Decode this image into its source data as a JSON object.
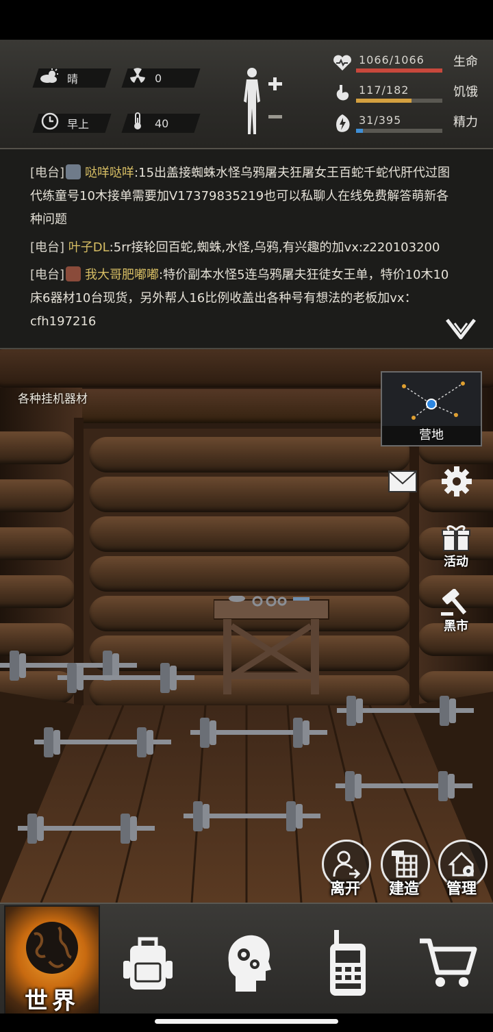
{
  "hud": {
    "weather": {
      "icon": "cloud-sun-icon",
      "label": "晴"
    },
    "radiation": {
      "icon": "radiation-icon",
      "value": "0"
    },
    "time": {
      "icon": "clock-icon",
      "label": "早上"
    },
    "temperature": {
      "icon": "thermometer-icon",
      "value": "40"
    },
    "stats": [
      {
        "icon": "heart-icon",
        "text": "1066/1066",
        "label": "生命",
        "fraction": 1.0,
        "color": "#c8483c"
      },
      {
        "icon": "stomach-icon",
        "text": "117/182",
        "label": "饥饿",
        "fraction": 0.643,
        "color": "#d4a040"
      },
      {
        "icon": "energy-icon",
        "text": "31/395",
        "label": "精力",
        "fraction": 0.078,
        "color": "#3f8fd6"
      }
    ]
  },
  "chat": {
    "messages": [
      {
        "tag": "[电台]",
        "name": "哒咩哒咩",
        "avatar_color": "#6f7b8a",
        "text": ":15出盖接蜘蛛水怪乌鸦屠夫狂屠女王百蛇千蛇代肝代过图代练童号10木接单需要加V17379835219也可以私聊人在线免费解答萌新各种问题"
      },
      {
        "tag": "[电台]",
        "name": "叶子DL",
        "avatar_color": "",
        "text": ":5rr接轮回百蛇,蜘蛛,水怪,乌鸦,有兴趣的加vx:z220103200"
      },
      {
        "tag": "[电台]",
        "name": "我大哥肥嘟嘟",
        "avatar_color": "#8a4b3a",
        "text": ":特价副本水怪5连乌鸦屠夫狂徒女王单，特价10木10床6器材10台现货，另外帮人16比例收盖出各种号有想法的老板加vx：cfh197216"
      }
    ]
  },
  "scene": {
    "location_caption": "各种挂机器材",
    "map_label": "营地",
    "side": {
      "mail_icon": "mail-icon",
      "settings_icon": "gear-icon",
      "event_label": "活动",
      "black_market_label": "黑市"
    },
    "actions": [
      {
        "label": "离开",
        "icon": "leave-icon"
      },
      {
        "label": "建造",
        "icon": "build-icon"
      },
      {
        "label": "管理",
        "icon": "manage-icon"
      }
    ]
  },
  "nav": {
    "world_label": "世界",
    "items": [
      "backpack-icon",
      "skills-head-icon",
      "radio-icon",
      "shop-cart-icon"
    ]
  }
}
